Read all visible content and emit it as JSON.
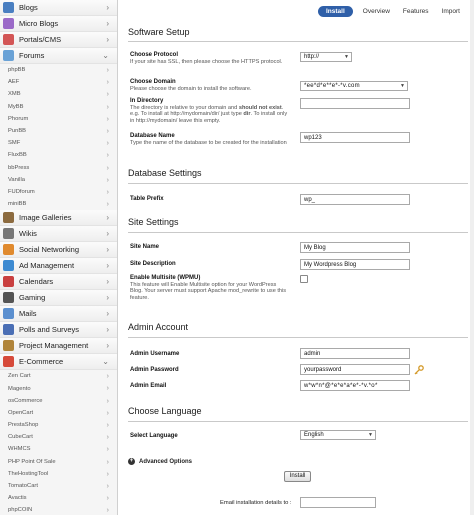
{
  "sidebar": {
    "categories": [
      {
        "label": "Blogs",
        "icon": "blog-icon",
        "color": "#4a7fc1"
      },
      {
        "label": "Micro Blogs",
        "icon": "micro-blog-icon",
        "color": "#9b6ac8"
      },
      {
        "label": "Portals/CMS",
        "icon": "portal-icon",
        "color": "#d35656"
      },
      {
        "label": "Forums",
        "icon": "forum-icon",
        "color": "#6aa2d6"
      }
    ],
    "forums": [
      "phpBB",
      "AEF",
      "XMB",
      "MyBB",
      "Phorum",
      "PunBB",
      "SMF",
      "FluxBB",
      "bbPress",
      "Vanilla",
      "FUDforum",
      "miniBB"
    ],
    "categories2": [
      {
        "label": "Image Galleries",
        "icon": "image-gallery-icon",
        "color": "#8c6b3f"
      },
      {
        "label": "Wikis",
        "icon": "wiki-icon",
        "color": "#777777"
      },
      {
        "label": "Social Networking",
        "icon": "social-icon",
        "color": "#e08a2e"
      },
      {
        "label": "Ad Management",
        "icon": "ad-icon",
        "color": "#3d8ad1"
      },
      {
        "label": "Calendars",
        "icon": "calendar-icon",
        "color": "#c94040"
      },
      {
        "label": "Gaming",
        "icon": "gaming-icon",
        "color": "#555555"
      },
      {
        "label": "Mails",
        "icon": "mail-icon",
        "color": "#5b8fcf"
      },
      {
        "label": "Polls and Surveys",
        "icon": "poll-icon",
        "color": "#4b6fb5"
      },
      {
        "label": "Project Management",
        "icon": "project-icon",
        "color": "#b0843a"
      },
      {
        "label": "E-Commerce",
        "icon": "ecommerce-icon",
        "color": "#d64a3a"
      }
    ],
    "ecommerce": [
      "Zen Cart",
      "Magento",
      "osCommerce",
      "OpenCart",
      "PrestaShop",
      "CubeCart",
      "WHMCS",
      "PHP Point Of Sale",
      "TheHostingTool",
      "TomatoCart",
      "Avactis",
      "phpCOIN"
    ]
  },
  "tabs": [
    {
      "label": "Install",
      "active": true
    },
    {
      "label": "Overview",
      "active": false
    },
    {
      "label": "Features",
      "active": false
    },
    {
      "label": "Import",
      "active": false
    }
  ],
  "sections": {
    "software_setup": "Software Setup",
    "database_settings": "Database Settings",
    "site_settings": "Site Settings",
    "admin_account": "Admin Account",
    "choose_language": "Choose Language"
  },
  "fields": {
    "protocol": {
      "label": "Choose Protocol",
      "help": "If your site has SSL, then please choose the HTTPS protocol.",
      "value": "http://"
    },
    "domain": {
      "label": "Choose Domain",
      "help": "Please choose the domain to install the software.",
      "value": "*ee*d*e**e*-*v.com"
    },
    "directory": {
      "label": "In Directory",
      "help_a": "The directory is relative to your domain and ",
      "help_b": "should not exist",
      "help_c": ". e.g. To install at http://mydomain/dir/ just type ",
      "help_d": "dir",
      "help_e": ". To install only in http://mydomain/ leave this empty.",
      "value": ""
    },
    "db_name": {
      "label": "Database Name",
      "help": "Type the name of the database to be created for the installation",
      "value": "wp123"
    },
    "table_prefix": {
      "label": "Table Prefix",
      "value": "wp_"
    },
    "site_name": {
      "label": "Site Name",
      "value": "My Blog"
    },
    "site_desc": {
      "label": "Site Description",
      "value": "My Wordpress Blog"
    },
    "multisite": {
      "label": "Enable Multisite (WPMU)",
      "help": "This feature will Enable Multisite option for your WordPress Blog. Your server must support Apache mod_rewrite to use this feature."
    },
    "admin_user": {
      "label": "Admin Username",
      "value": "admin"
    },
    "admin_pass": {
      "label": "Admin Password",
      "value": "yourpassword"
    },
    "admin_email": {
      "label": "Admin Email",
      "value": "w*w*n*@*e*e*a*e*-*v.*o*"
    },
    "language": {
      "label": "Select Language",
      "value": "English"
    }
  },
  "advanced_options": "Advanced Options",
  "install_button": "Install",
  "email_details_label": "Email installation details to :"
}
